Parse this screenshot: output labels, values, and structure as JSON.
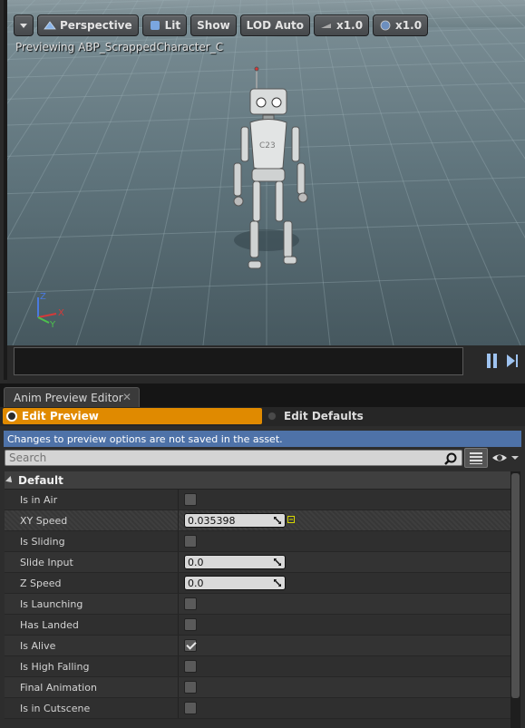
{
  "viewport": {
    "menu_label": "",
    "perspective_label": "Perspective",
    "lit_label": "Lit",
    "show_label": "Show",
    "lod_label": "LOD Auto",
    "speed_label": "x1.0",
    "rate_label": "x1.0",
    "preview_title": "Previewing ABP_ScrappedCharacter_C",
    "robot_tag": "C23",
    "axes": {
      "z": "Z",
      "x": "X",
      "y": "Y"
    }
  },
  "panel": {
    "tab_label": "Anim Preview Editor",
    "tab_close": "✕",
    "edit_preview_label": "Edit Preview",
    "edit_defaults_label": "Edit Defaults",
    "notice": "Changes to preview options are not saved in the asset.",
    "search_placeholder": "Search",
    "category": "Default",
    "properties": [
      {
        "name": "Is in Air",
        "type": "bool",
        "value": false
      },
      {
        "name": "XY Speed",
        "type": "float",
        "value": "0.035398"
      },
      {
        "name": "Is Sliding",
        "type": "bool",
        "value": false
      },
      {
        "name": "Slide Input",
        "type": "float",
        "value": "0.0"
      },
      {
        "name": "Z Speed",
        "type": "float",
        "value": "0.0"
      },
      {
        "name": "Is Launching",
        "type": "bool",
        "value": false
      },
      {
        "name": "Has Landed",
        "type": "bool",
        "value": false
      },
      {
        "name": "Is Alive",
        "type": "bool",
        "value": true
      },
      {
        "name": "Is High Falling",
        "type": "bool",
        "value": false
      },
      {
        "name": "Final Animation",
        "type": "bool",
        "value": false
      },
      {
        "name": "Is in Cutscene",
        "type": "bool",
        "value": false
      }
    ]
  },
  "colors": {
    "accent": "#e08a00",
    "notice_bg": "#4e72a8",
    "axis_x": "#d43a3a",
    "axis_y": "#4cc24c",
    "axis_z": "#4a7ae0"
  }
}
